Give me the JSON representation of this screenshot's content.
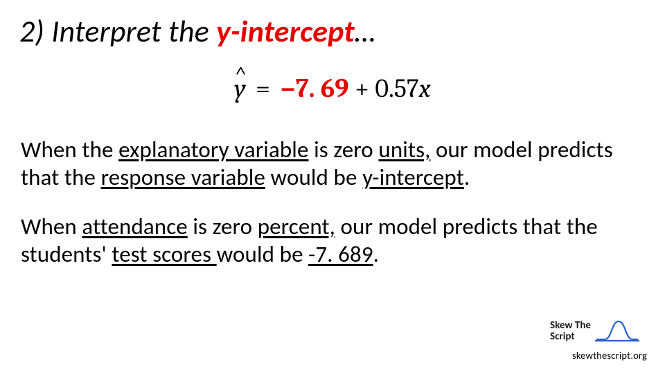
{
  "title": {
    "prefix": "2) Interpret the ",
    "accent": "y-intercept",
    "suffix": "…"
  },
  "equation": {
    "yhat": "y",
    "hat": "^",
    "eq": " = ",
    "neg": "−7. 69",
    "plus": " + 0.57",
    "xvar": "x"
  },
  "p1": {
    "t0": "When the ",
    "u1": "explanatory variable",
    "t1": " is zero ",
    "u2": "units,",
    "t2": " our model predicts that the ",
    "u3": "response variable",
    "t3": " would be ",
    "u4": "y-intercept",
    "t4": "."
  },
  "p2": {
    "t0": "When ",
    "u1": "attendance",
    "t1": " is zero ",
    "u2": "percent,",
    "t2": " our model predicts that the students' ",
    "u3": "test scores ",
    "t3": "would be ",
    "u4": "-7. 689",
    "t4": "."
  },
  "logo": {
    "line1": "Skew The",
    "line2": "Script"
  },
  "attribution": "skewthescript.org"
}
